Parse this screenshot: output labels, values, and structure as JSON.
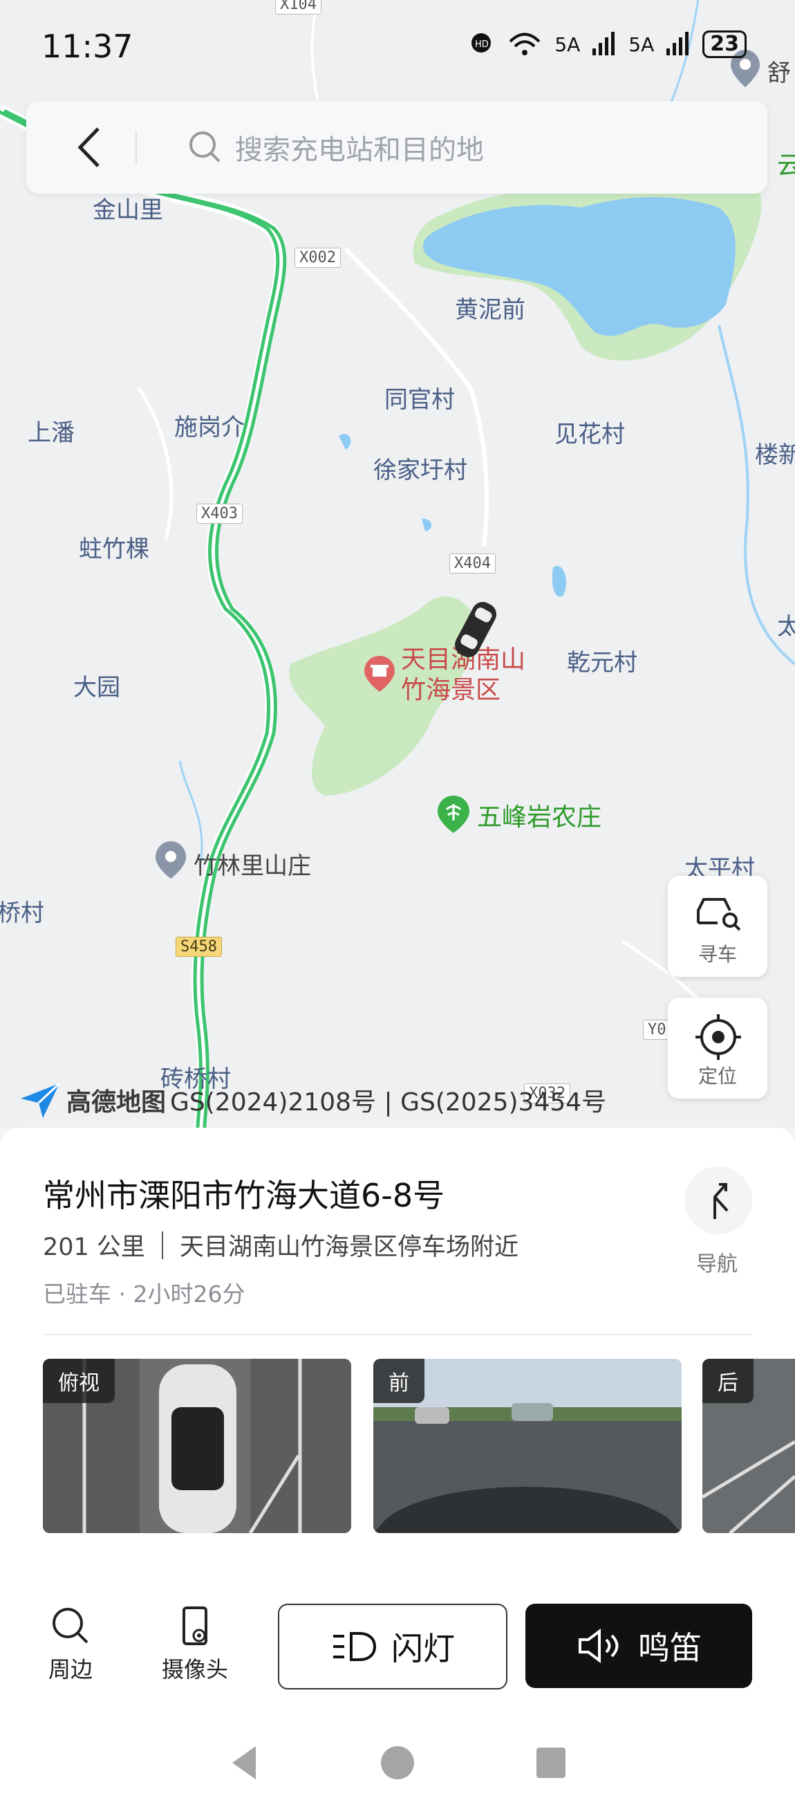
{
  "status_bar": {
    "time": "11:37",
    "signal1": "5A",
    "signal2": "5A",
    "battery": "23"
  },
  "search": {
    "placeholder": "搜索充电站和目的地"
  },
  "map": {
    "places": {
      "jinshanli": "金山里",
      "huangniqian": "黄泥前",
      "tongguancun": "同官村",
      "shanggangjie": "施岗介",
      "shangpan": "上潘",
      "jianhuacun": "见花村",
      "xujiaqiancun": "徐家圩村",
      "zhuzhuke": "蛀竹棵",
      "dayuan": "大园",
      "qianyuancun": "乾元村",
      "louxin": "楼新",
      "taipingcun": "太平村",
      "zhuanqiaocun": "砖桥村",
      "qiaocun": "桥村",
      "shu": "舒",
      "yun": "云",
      "tai": "太"
    },
    "scenic_name_line1": "天目湖南山",
    "scenic_name_line2": "竹海景区",
    "farm_name": "五峰岩农庄",
    "inn_name": "竹林里山庄",
    "roads": {
      "x002": "X002",
      "x403": "X403",
      "x404": "X404",
      "s458": "S458",
      "x032": "X032",
      "y0": "Y0",
      "x104": "X104"
    },
    "find_car_label": "寻车",
    "locate_label": "定位",
    "attribution_brand": "高德地图",
    "attribution_license": "GS(2024)2108号 | GS(2025)3454号"
  },
  "panel": {
    "address": "常州市溧阳市竹海大道6-8号",
    "distance": "201 公里",
    "nearby": "天目湖南山竹海景区停车场附近",
    "parked": "已驻车 · 2小时26分",
    "nav_label": "导航",
    "cameras": [
      {
        "label": "俯视"
      },
      {
        "label": "前"
      },
      {
        "label": "后"
      }
    ],
    "tools": {
      "nearby_label": "周边",
      "camera_label": "摄像头",
      "flash_label": "闪灯",
      "horn_label": "鸣笛"
    }
  },
  "colors": {
    "accent": "#111111",
    "map_green": "#cbe9c0",
    "road_green": "#3cc46f",
    "water": "#8ecbf3"
  }
}
